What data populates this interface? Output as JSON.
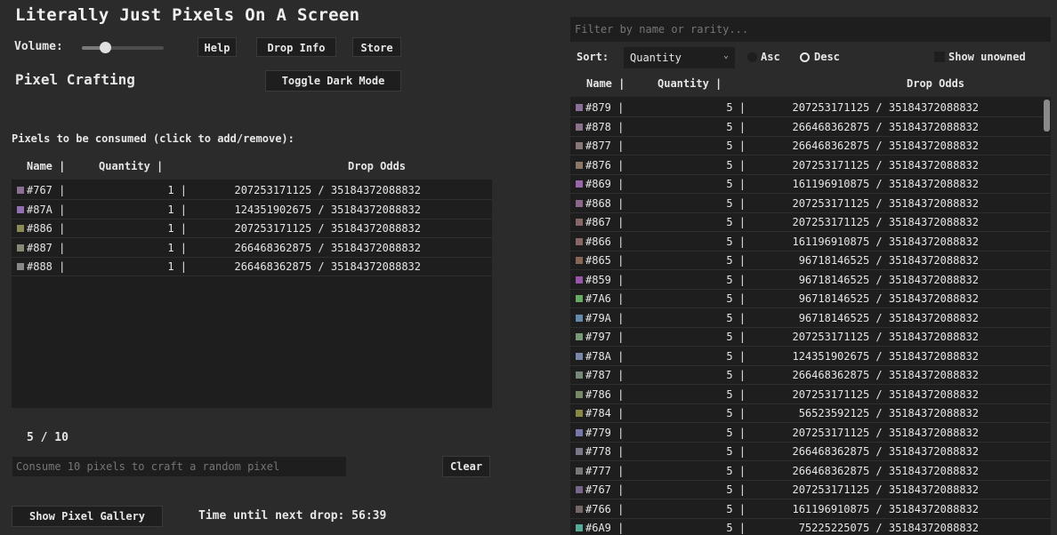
{
  "app": {
    "title": "Literally Just Pixels On A Screen"
  },
  "volume": {
    "label": "Volume:",
    "level": 0.28
  },
  "toolbar": {
    "help": "Help",
    "drop_info": "Drop Info",
    "store": "Store",
    "toggle_dark": "Toggle Dark Mode"
  },
  "crafting": {
    "title": "Pixel Crafting",
    "consume_label": "Pixels to be consumed (click to add/remove):",
    "columns": {
      "name": "Name |",
      "quantity": "Quantity |",
      "odds": "Drop Odds"
    },
    "rows": [
      {
        "color": "#8a6f92",
        "name": "#767 |",
        "qty": "1 |",
        "odds": "207253171125 / 35184372088832"
      },
      {
        "color": "#9070b0",
        "name": "#87A |",
        "qty": "1 |",
        "odds": "124351902675 / 35184372088832"
      },
      {
        "color": "#8a8a55",
        "name": "#886 |",
        "qty": "1 |",
        "odds": "207253171125 / 35184372088832"
      },
      {
        "color": "#888877",
        "name": "#887 |",
        "qty": "1 |",
        "odds": "266468362875 / 35184372088832"
      },
      {
        "color": "#888888",
        "name": "#888 |",
        "qty": "1 |",
        "odds": "266468362875 / 35184372088832"
      }
    ],
    "count": "5 / 10",
    "consume_placeholder": "Consume 10 pixels to craft a random pixel",
    "clear": "Clear",
    "gallery": "Show Pixel Gallery",
    "timer": "Time until next drop: 56:39"
  },
  "inventory": {
    "filter_placeholder": "Filter by name or rarity...",
    "sort_label": "Sort:",
    "sort_value": "Quantity",
    "asc": "Asc",
    "desc": "Desc",
    "show_unowned": "Show unowned",
    "columns": {
      "name": "Name |",
      "quantity": "Quantity |",
      "odds": "Drop Odds"
    },
    "rows": [
      {
        "color": "#8a7099",
        "name": "#879 |",
        "qty": "5 |",
        "odds": "207253171125 / 35184372088832"
      },
      {
        "color": "#8a7088",
        "name": "#878 |",
        "qty": "5 |",
        "odds": "266468362875 / 35184372088832"
      },
      {
        "color": "#887777",
        "name": "#877 |",
        "qty": "5 |",
        "odds": "266468362875 / 35184372088832"
      },
      {
        "color": "#8a7766",
        "name": "#876 |",
        "qty": "5 |",
        "odds": "207253171125 / 35184372088832"
      },
      {
        "color": "#9966aa",
        "name": "#869 |",
        "qty": "5 |",
        "odds": "161196910875 / 35184372088832"
      },
      {
        "color": "#8a6688",
        "name": "#868 |",
        "qty": "5 |",
        "odds": "207253171125 / 35184372088832"
      },
      {
        "color": "#886666",
        "name": "#867 |",
        "qty": "5 |",
        "odds": "207253171125 / 35184372088832"
      },
      {
        "color": "#886666",
        "name": "#866 |",
        "qty": "5 |",
        "odds": "161196910875 / 35184372088832"
      },
      {
        "color": "#886655",
        "name": "#865 |",
        "qty": "5 |",
        "odds": "96718146525 / 35184372088832"
      },
      {
        "color": "#9955aa",
        "name": "#859 |",
        "qty": "5 |",
        "odds": "96718146525 / 35184372088832"
      },
      {
        "color": "#66aa66",
        "name": "#7A6 |",
        "qty": "5 |",
        "odds": "96718146525 / 35184372088832"
      },
      {
        "color": "#6688aa",
        "name": "#79A |",
        "qty": "5 |",
        "odds": "96718146525 / 35184372088832"
      },
      {
        "color": "#779977",
        "name": "#797 |",
        "qty": "5 |",
        "odds": "207253171125 / 35184372088832"
      },
      {
        "color": "#7788aa",
        "name": "#78A |",
        "qty": "5 |",
        "odds": "124351902675 / 35184372088832"
      },
      {
        "color": "#778877",
        "name": "#787 |",
        "qty": "5 |",
        "odds": "266468362875 / 35184372088832"
      },
      {
        "color": "#778866",
        "name": "#786 |",
        "qty": "5 |",
        "odds": "207253171125 / 35184372088832"
      },
      {
        "color": "#888844",
        "name": "#784 |",
        "qty": "5 |",
        "odds": "56523592125 / 35184372088832"
      },
      {
        "color": "#7777aa",
        "name": "#779 |",
        "qty": "5 |",
        "odds": "207253171125 / 35184372088832"
      },
      {
        "color": "#777788",
        "name": "#778 |",
        "qty": "5 |",
        "odds": "266468362875 / 35184372088832"
      },
      {
        "color": "#777777",
        "name": "#777 |",
        "qty": "5 |",
        "odds": "266468362875 / 35184372088832"
      },
      {
        "color": "#776688",
        "name": "#767 |",
        "qty": "5 |",
        "odds": "207253171125 / 35184372088832"
      },
      {
        "color": "#776666",
        "name": "#766 |",
        "qty": "5 |",
        "odds": "161196910875 / 35184372088832"
      },
      {
        "color": "#55aa99",
        "name": "#6A9 |",
        "qty": "5 |",
        "odds": "75225225075 / 35184372088832"
      }
    ]
  }
}
